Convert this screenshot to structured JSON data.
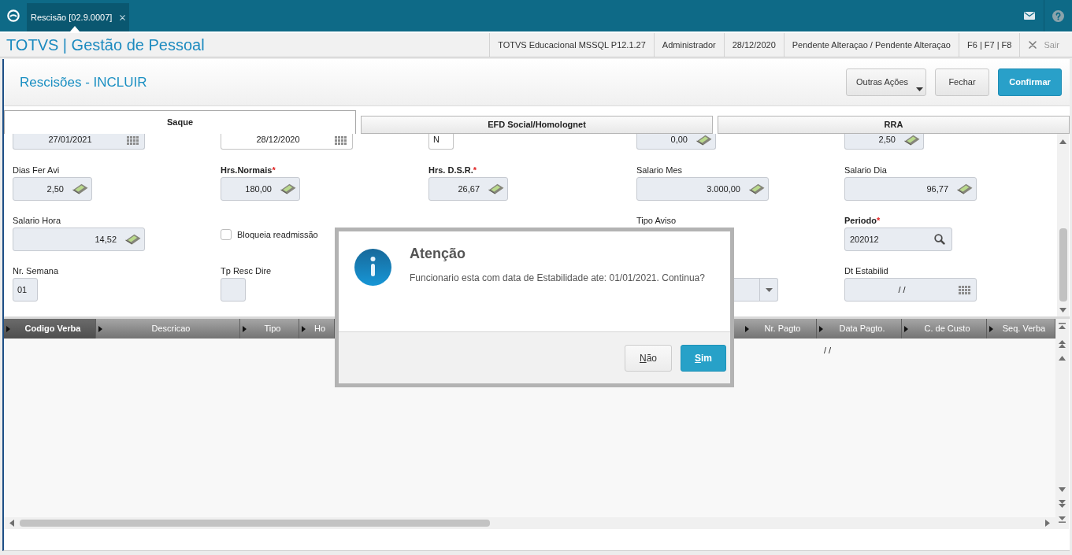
{
  "top_bar": {
    "tabs": [
      {
        "label": "Rescisão [02.9.0007]",
        "selected": true
      }
    ]
  },
  "app_bar": {
    "title": "TOTVS | Gestão de Pessoal",
    "info": [
      "TOTVS Educacional MSSQL P12.1.27",
      "Administrador",
      "28/12/2020",
      "Pendente Alteraçao / Pendente Alteraçao",
      "F6 | F7 | F8"
    ],
    "exit": "Sair"
  },
  "page": {
    "title": "Rescisões - INCLUIR",
    "buttons": [
      {
        "label": "Outras Ações",
        "kind": "menu"
      },
      {
        "label": "Fechar",
        "kind": "default"
      },
      {
        "label": "Confirmar",
        "kind": "primary"
      }
    ]
  },
  "tabs": [
    {
      "label": "Saque",
      "selected": true
    },
    {
      "label": "EFD Social/Homolognet",
      "selected": false
    },
    {
      "label": "RRA",
      "selected": false
    }
  ],
  "form": {
    "columns": [
      {
        "fields": [
          {
            "kind": "date",
            "value": "27/01/2021",
            "disabled": true
          },
          {
            "kind": "quantity",
            "label": "Dias Fer Avi",
            "value": "2,50",
            "disabled": true
          },
          {
            "kind": "currency",
            "label": "Salario Hora",
            "value": "14,52",
            "disabled": true
          },
          {
            "kind": "text",
            "label": "Nr. Semana",
            "value": "01",
            "disabled": true
          }
        ]
      },
      {
        "fields": [
          {
            "kind": "date",
            "value": "28/12/2020",
            "disabled": false
          },
          {
            "kind": "quantity",
            "label": "Hrs.Normais",
            "required_mark": "*",
            "value": "180,00",
            "disabled": true
          },
          {
            "kind": "checkbox",
            "label": "Bloqueia readmissão",
            "checked": false,
            "disabled": false
          },
          {
            "kind": "text",
            "label": "Tp Resc Dire",
            "disabled": true
          }
        ]
      },
      {
        "fields": [
          {
            "kind": "text",
            "value": "N",
            "disabled": false
          },
          {
            "kind": "quantity",
            "label": "Hrs. D.S.R.",
            "required_mark": "*",
            "value": "26,67",
            "disabled": true
          }
        ]
      },
      {
        "fields": [
          {
            "kind": "quantity",
            "value": "0,00",
            "disabled": true
          },
          {
            "kind": "currency",
            "label": "Salario Mes",
            "value": "3.000,00",
            "disabled": true
          },
          {
            "kind": "label",
            "label": "Tipo Aviso"
          },
          {
            "kind": "combo",
            "disabled": true
          }
        ]
      },
      {
        "fields": [
          {
            "kind": "quantity",
            "value": "2,50",
            "disabled": true
          },
          {
            "kind": "currency",
            "label": "Salario Dia",
            "value": "96,77",
            "disabled": true
          },
          {
            "kind": "lookup",
            "label": "Periodo",
            "required_mark": "*",
            "value": "202012",
            "disabled": true
          },
          {
            "kind": "date",
            "label": "Dt Estabilid",
            "value": "/ /",
            "disabled": true
          }
        ]
      }
    ]
  },
  "grid": {
    "columns": [
      {
        "label": "Codigo Verba",
        "selected": true
      },
      {
        "label": "Descricao",
        "selected": false
      },
      {
        "label": "Tipo",
        "selected": false
      },
      {
        "label": "Ho",
        "selected": false
      },
      {
        "label": "Nr. Pagto",
        "selected": false
      },
      {
        "label": "Data Pagto.",
        "selected": false,
        "cells": [
          "/ /"
        ]
      },
      {
        "label": "C. de Custo",
        "selected": false
      },
      {
        "label": "Seq. Verba",
        "selected": false
      }
    ]
  },
  "dialog": {
    "title": "Atenção",
    "message": "Funcionario esta com data de Estabilidade ate: 01/01/2021. Continua?",
    "buttons": [
      {
        "label": "Não",
        "kind": "default",
        "underline_first_letter": true
      },
      {
        "label": "Sim",
        "kind": "primary",
        "underline_first_letter": true
      }
    ]
  }
}
